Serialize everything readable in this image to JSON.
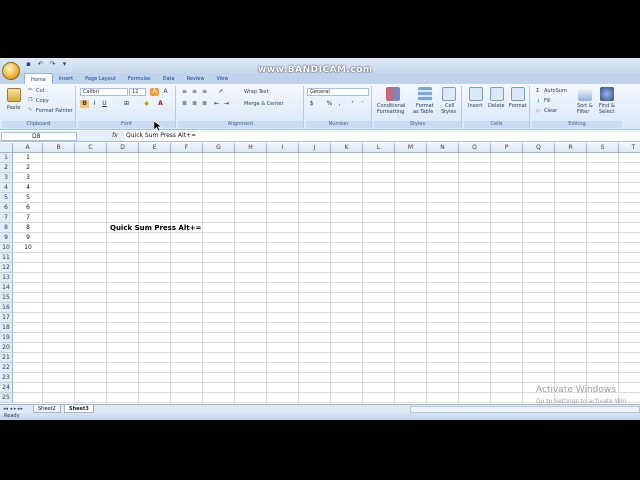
{
  "watermark": "www.BANDICAM.com",
  "ribbon_tabs": [
    "Home",
    "Insert",
    "Page Layout",
    "Formulas",
    "Data",
    "Review",
    "View"
  ],
  "clipboard": {
    "paste": "Paste",
    "cut": "Cut",
    "copy": "Copy",
    "format_painter": "Format Painter",
    "label": "Clipboard"
  },
  "font": {
    "name": "Calibri",
    "size": "12",
    "bold": "B",
    "italic": "I",
    "underline": "U",
    "label": "Font"
  },
  "alignment": {
    "wrap_text": "Wrap Text",
    "merge_center": "Merge & Center",
    "label": "Alignment"
  },
  "number": {
    "format": "General",
    "currency": "$",
    "percent": "%",
    "comma": ",",
    "label": "Number"
  },
  "styles": {
    "conditional": "Conditional",
    "conditional2": "Formatting",
    "format_as": "Format",
    "format_as2": "as Table",
    "cell": "Cell",
    "cell2": "Styles",
    "label": "Styles"
  },
  "cells": {
    "insert": "Insert",
    "delete": "Delete",
    "format": "Format",
    "label": "Cells"
  },
  "editing": {
    "autosum": "AutoSum",
    "fill": "Fill",
    "clear": "Clear",
    "sort": "Sort &",
    "sort2": "Filter",
    "find": "Find &",
    "find2": "Select",
    "label": "Editing"
  },
  "formula_bar": {
    "name_box": "D8",
    "fx": "fx",
    "content": "Quick Sum Press   Alt+="
  },
  "columns": [
    "A",
    "B",
    "C",
    "D",
    "E",
    "F",
    "G",
    "H",
    "I",
    "J",
    "K",
    "L",
    "M",
    "N",
    "O",
    "P",
    "Q",
    "R",
    "S",
    "T"
  ],
  "row_count": 25,
  "column_a_values": [
    "1",
    "2",
    "3",
    "4",
    "5",
    "6",
    "7",
    "8",
    "9",
    "10"
  ],
  "cell_d8": "Quick Sum Press   Alt+=",
  "sheets": [
    "Sheet2",
    "Sheet3"
  ],
  "active_sheet": "Sheet3",
  "status": "Ready",
  "activate_windows": {
    "title": "Activate Windows",
    "subtitle": "Go to Settings to activate Win"
  }
}
